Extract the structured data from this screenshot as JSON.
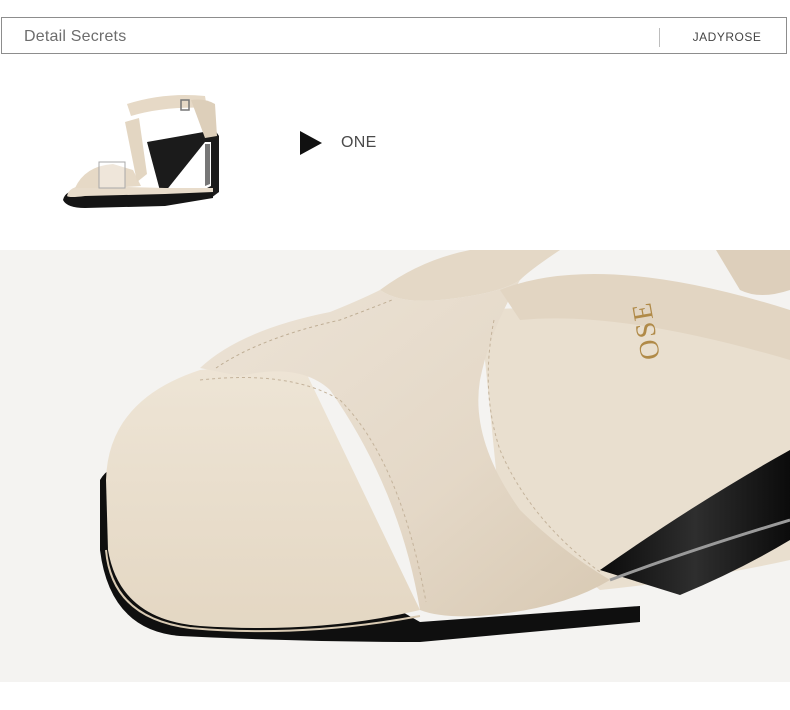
{
  "header": {
    "title": "Detail Secrets",
    "brand": "JADYROSE"
  },
  "section": {
    "label": "ONE"
  },
  "photo": {
    "insole_print": "OSE"
  },
  "colors": {
    "suede": "#e7dccd",
    "leather": "#eae0cf",
    "sole": "#111111",
    "background": "#f4f3f1"
  }
}
